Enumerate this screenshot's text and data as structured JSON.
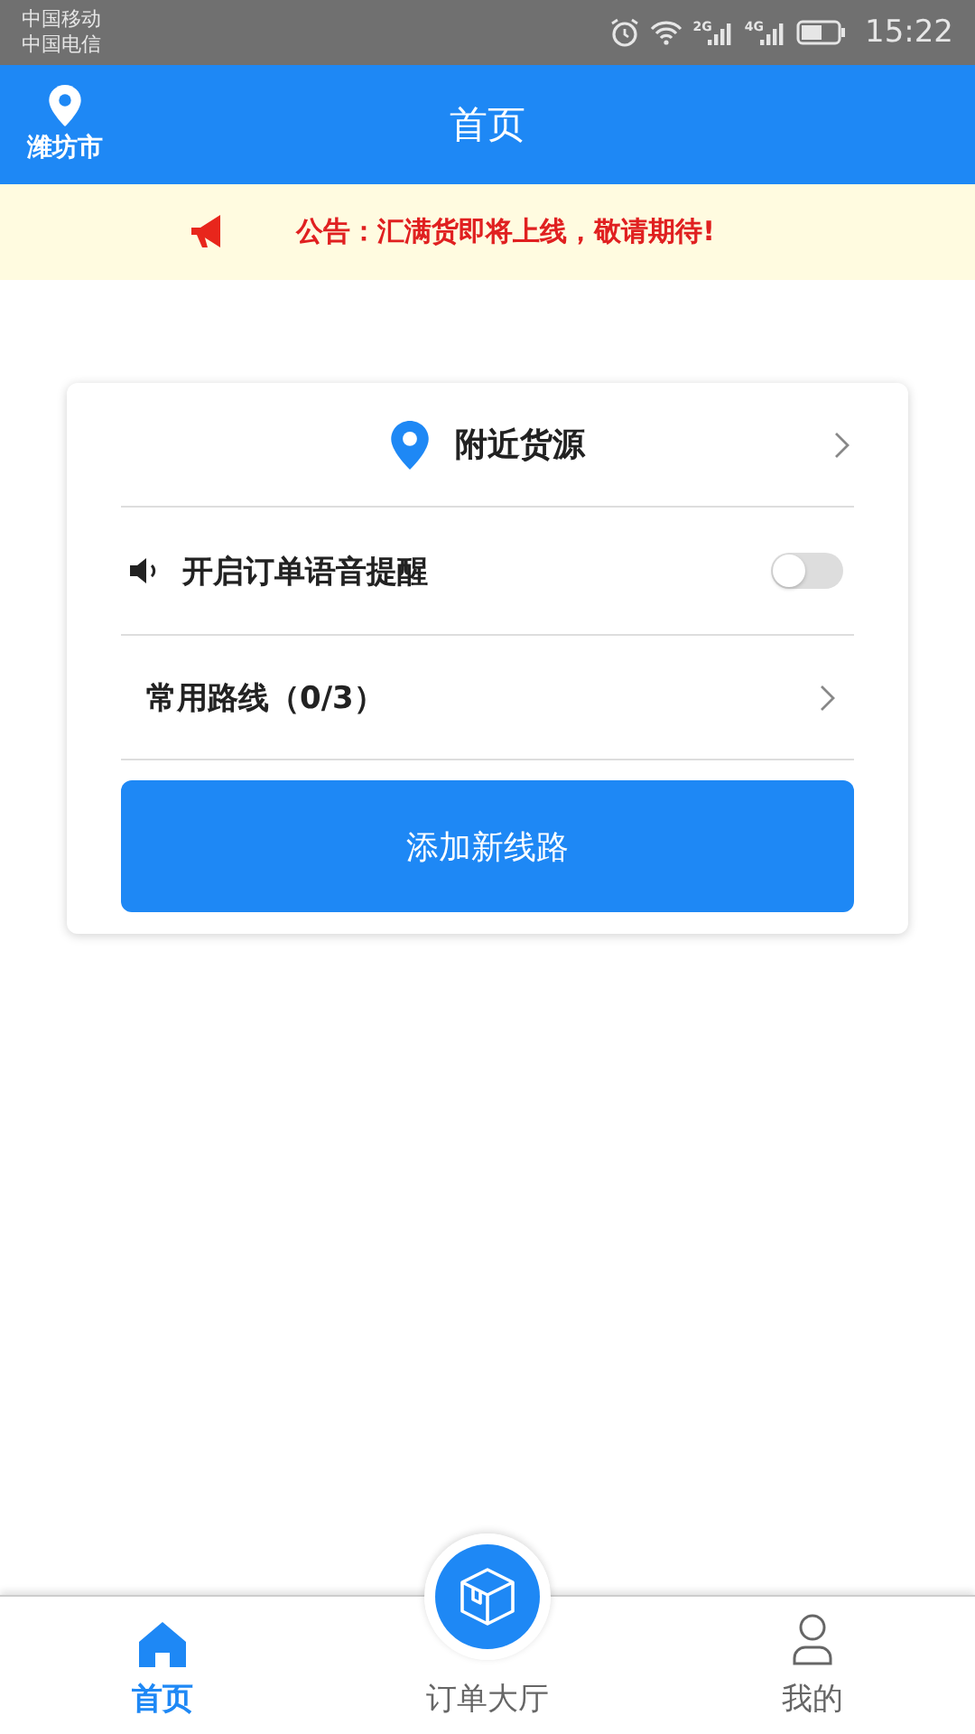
{
  "status_bar": {
    "carriers": [
      "中国移动",
      "中国电信"
    ],
    "signals": [
      "2G",
      "4G"
    ],
    "time": "15:22"
  },
  "app_bar": {
    "location": "潍坊市",
    "title": "首页"
  },
  "notice": {
    "text": "公告：汇满货即将上线，敬请期待!"
  },
  "card": {
    "nearby": "附近货源",
    "voice_alert": {
      "label": "开启订单语音提醒",
      "on": false
    },
    "routes": "常用路线（0/3）",
    "add_button": "添加新线路"
  },
  "tabs": [
    {
      "kind": "home",
      "label": "首页",
      "selected": true
    },
    {
      "kind": "center",
      "label": "订单大厅",
      "selected": false
    },
    {
      "kind": "profile",
      "label": "我的",
      "selected": false
    }
  ]
}
